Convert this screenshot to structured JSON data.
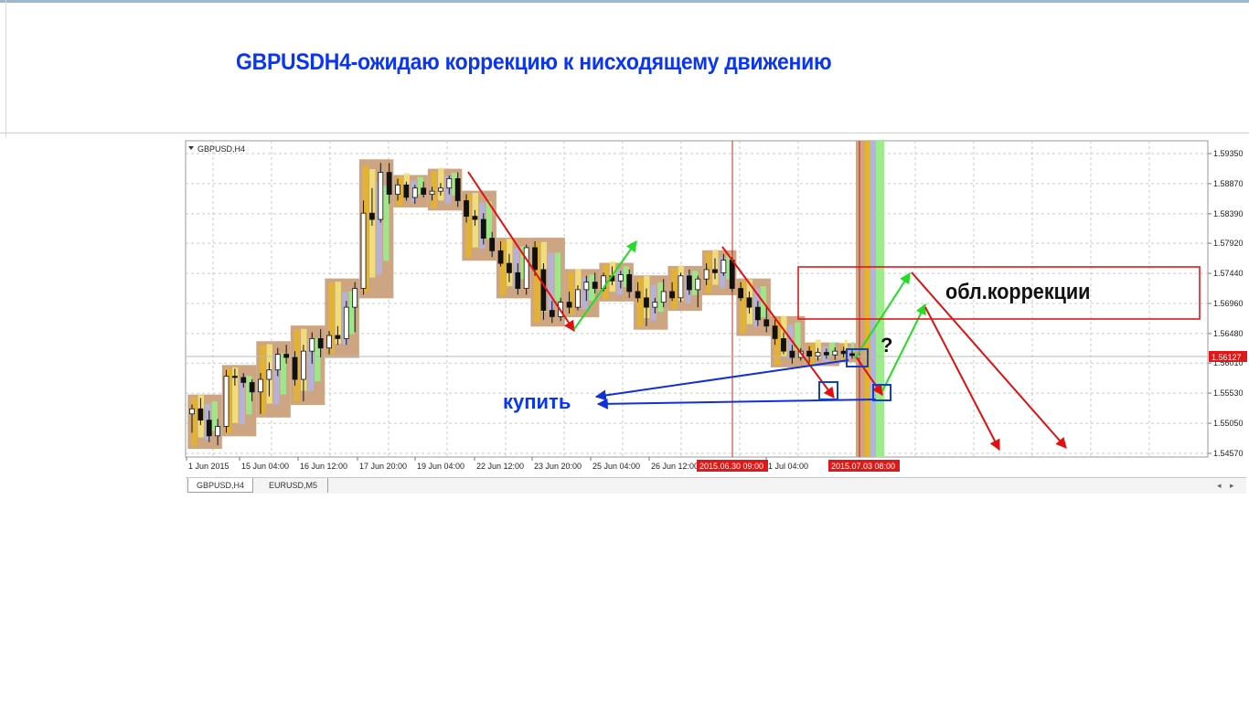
{
  "page": {
    "title": "GBPUSDH4-ожидаю коррекцию к нисходящему движению"
  },
  "tabs": {
    "active": "GBPUSD,H4",
    "other": "EURUSD,M5",
    "scroll_left": "◂",
    "scroll_right": "▸"
  },
  "chart_data": {
    "type": "candlestick",
    "symbol_label": "GBPUSD,H4",
    "ylim": [
      1.5442,
      1.5955
    ],
    "y_ticks": [
      "1.59350",
      "1.58870",
      "1.58390",
      "1.57920",
      "1.57440",
      "1.56960",
      "1.56480",
      "1.56010",
      "1.55530",
      "1.55050",
      "1.54570"
    ],
    "x_tick_labels": [
      "1 Jun 2015",
      "15 Jun 04:00",
      "16 Jun 12:00",
      "17 Jun 20:00",
      "19 Jun 04:00",
      "22 Jun 12:00",
      "23 Jun 20:00",
      "25 Jun 04:00",
      "26 Jun 12:00",
      "1 Jul 04:00"
    ],
    "x_highlight_labels": [
      "2015.06.30 09:00",
      "2015.07.03 08:00"
    ],
    "current_price": "1.56127",
    "grid": true,
    "annotations": {
      "buy_label": "купить",
      "zone_label": "обл.коррекции",
      "question_mark": "?"
    },
    "colors": {
      "title": "#0a35f2",
      "buy_label": "#0a35f2",
      "arrow_down": "#e01010",
      "arrow_up": "#22dd22",
      "arrow_buy": "#1030d8",
      "zone_box": "#e01818",
      "marker_box": "#1040d0",
      "price_badge_bg": "#e01818",
      "band_tan": "#cda583",
      "band_gold": "#e4b42a",
      "band_yellow": "#f3e27a",
      "band_lavender": "#b3b3e0",
      "band_green": "#9cec8c",
      "vline": "#d02020"
    },
    "candles": [
      {
        "o": 1.552,
        "h": 1.5535,
        "l": 1.549,
        "c": 1.5528
      },
      {
        "o": 1.5528,
        "h": 1.5545,
        "l": 1.5502,
        "c": 1.551
      },
      {
        "o": 1.551,
        "h": 1.5525,
        "l": 1.5475,
        "c": 1.5485
      },
      {
        "o": 1.5485,
        "h": 1.5512,
        "l": 1.547,
        "c": 1.55
      },
      {
        "o": 1.55,
        "h": 1.559,
        "l": 1.549,
        "c": 1.558
      },
      {
        "o": 1.558,
        "h": 1.5592,
        "l": 1.5565,
        "c": 1.5578
      },
      {
        "o": 1.5578,
        "h": 1.5585,
        "l": 1.5562,
        "c": 1.557
      },
      {
        "o": 1.557,
        "h": 1.5575,
        "l": 1.554,
        "c": 1.5555
      },
      {
        "o": 1.5555,
        "h": 1.5585,
        "l": 1.552,
        "c": 1.5575
      },
      {
        "o": 1.5575,
        "h": 1.5602,
        "l": 1.5548,
        "c": 1.559
      },
      {
        "o": 1.559,
        "h": 1.5625,
        "l": 1.558,
        "c": 1.5615
      },
      {
        "o": 1.5615,
        "h": 1.563,
        "l": 1.56,
        "c": 1.561
      },
      {
        "o": 1.561,
        "h": 1.562,
        "l": 1.5565,
        "c": 1.5575
      },
      {
        "o": 1.5575,
        "h": 1.563,
        "l": 1.554,
        "c": 1.562
      },
      {
        "o": 1.562,
        "h": 1.565,
        "l": 1.56,
        "c": 1.564
      },
      {
        "o": 1.564,
        "h": 1.5655,
        "l": 1.561,
        "c": 1.5625
      },
      {
        "o": 1.5625,
        "h": 1.5652,
        "l": 1.5615,
        "c": 1.5645
      },
      {
        "o": 1.5645,
        "h": 1.566,
        "l": 1.563,
        "c": 1.564
      },
      {
        "o": 1.564,
        "h": 1.57,
        "l": 1.563,
        "c": 1.569
      },
      {
        "o": 1.569,
        "h": 1.573,
        "l": 1.565,
        "c": 1.572
      },
      {
        "o": 1.572,
        "h": 1.586,
        "l": 1.571,
        "c": 1.584
      },
      {
        "o": 1.584,
        "h": 1.588,
        "l": 1.582,
        "c": 1.583
      },
      {
        "o": 1.583,
        "h": 1.592,
        "l": 1.5825,
        "c": 1.5905
      },
      {
        "o": 1.5905,
        "h": 1.592,
        "l": 1.5855,
        "c": 1.587
      },
      {
        "o": 1.587,
        "h": 1.5895,
        "l": 1.586,
        "c": 1.5885
      },
      {
        "o": 1.5885,
        "h": 1.589,
        "l": 1.586,
        "c": 1.5865
      },
      {
        "o": 1.5865,
        "h": 1.5885,
        "l": 1.5855,
        "c": 1.588
      },
      {
        "o": 1.588,
        "h": 1.589,
        "l": 1.5865,
        "c": 1.587
      },
      {
        "o": 1.587,
        "h": 1.5882,
        "l": 1.586,
        "c": 1.5875
      },
      {
        "o": 1.5875,
        "h": 1.5888,
        "l": 1.5868,
        "c": 1.588
      },
      {
        "o": 1.588,
        "h": 1.59,
        "l": 1.587,
        "c": 1.5895
      },
      {
        "o": 1.5895,
        "h": 1.5905,
        "l": 1.585,
        "c": 1.586
      },
      {
        "o": 1.586,
        "h": 1.587,
        "l": 1.5825,
        "c": 1.5835
      },
      {
        "o": 1.5835,
        "h": 1.5845,
        "l": 1.582,
        "c": 1.583
      },
      {
        "o": 1.583,
        "h": 1.584,
        "l": 1.579,
        "c": 1.58
      },
      {
        "o": 1.58,
        "h": 1.581,
        "l": 1.577,
        "c": 1.578
      },
      {
        "o": 1.578,
        "h": 1.5795,
        "l": 1.5755,
        "c": 1.576
      },
      {
        "o": 1.576,
        "h": 1.5775,
        "l": 1.573,
        "c": 1.5745
      },
      {
        "o": 1.5745,
        "h": 1.576,
        "l": 1.571,
        "c": 1.572
      },
      {
        "o": 1.572,
        "h": 1.579,
        "l": 1.571,
        "c": 1.5785
      },
      {
        "o": 1.5785,
        "h": 1.5795,
        "l": 1.574,
        "c": 1.575
      },
      {
        "o": 1.575,
        "h": 1.576,
        "l": 1.567,
        "c": 1.5685
      },
      {
        "o": 1.5685,
        "h": 1.57,
        "l": 1.5665,
        "c": 1.5675
      },
      {
        "o": 1.5675,
        "h": 1.5705,
        "l": 1.5668,
        "c": 1.5698
      },
      {
        "o": 1.5698,
        "h": 1.5715,
        "l": 1.568,
        "c": 1.569
      },
      {
        "o": 1.569,
        "h": 1.5725,
        "l": 1.5685,
        "c": 1.5718
      },
      {
        "o": 1.5718,
        "h": 1.574,
        "l": 1.57,
        "c": 1.573
      },
      {
        "o": 1.573,
        "h": 1.5745,
        "l": 1.5712,
        "c": 1.572
      },
      {
        "o": 1.572,
        "h": 1.5745,
        "l": 1.5715,
        "c": 1.574
      },
      {
        "o": 1.574,
        "h": 1.5755,
        "l": 1.5725,
        "c": 1.5732
      },
      {
        "o": 1.5732,
        "h": 1.5748,
        "l": 1.572,
        "c": 1.5742
      },
      {
        "o": 1.5742,
        "h": 1.575,
        "l": 1.5705,
        "c": 1.5715
      },
      {
        "o": 1.5715,
        "h": 1.573,
        "l": 1.5698,
        "c": 1.5705
      },
      {
        "o": 1.5705,
        "h": 1.572,
        "l": 1.566,
        "c": 1.569
      },
      {
        "o": 1.569,
        "h": 1.5705,
        "l": 1.568,
        "c": 1.5698
      },
      {
        "o": 1.5698,
        "h": 1.5735,
        "l": 1.569,
        "c": 1.5715
      },
      {
        "o": 1.5715,
        "h": 1.573,
        "l": 1.57,
        "c": 1.5705
      },
      {
        "o": 1.5705,
        "h": 1.5745,
        "l": 1.5698,
        "c": 1.574
      },
      {
        "o": 1.574,
        "h": 1.575,
        "l": 1.571,
        "c": 1.5718
      },
      {
        "o": 1.5718,
        "h": 1.574,
        "l": 1.569,
        "c": 1.5735
      },
      {
        "o": 1.5735,
        "h": 1.576,
        "l": 1.5725,
        "c": 1.575
      },
      {
        "o": 1.575,
        "h": 1.5768,
        "l": 1.5735,
        "c": 1.5745
      },
      {
        "o": 1.5745,
        "h": 1.5775,
        "l": 1.574,
        "c": 1.5765
      },
      {
        "o": 1.5765,
        "h": 1.577,
        "l": 1.5715,
        "c": 1.572
      },
      {
        "o": 1.572,
        "h": 1.573,
        "l": 1.57,
        "c": 1.5705
      },
      {
        "o": 1.5705,
        "h": 1.5715,
        "l": 1.568,
        "c": 1.569
      },
      {
        "o": 1.569,
        "h": 1.57,
        "l": 1.566,
        "c": 1.567
      },
      {
        "o": 1.567,
        "h": 1.569,
        "l": 1.565,
        "c": 1.566
      },
      {
        "o": 1.566,
        "h": 1.567,
        "l": 1.563,
        "c": 1.564
      },
      {
        "o": 1.564,
        "h": 1.565,
        "l": 1.5615,
        "c": 1.562
      },
      {
        "o": 1.562,
        "h": 1.563,
        "l": 1.56,
        "c": 1.561
      },
      {
        "o": 1.561,
        "h": 1.5625,
        "l": 1.5605,
        "c": 1.562
      },
      {
        "o": 1.562,
        "h": 1.5628,
        "l": 1.5602,
        "c": 1.5612
      },
      {
        "o": 1.5612,
        "h": 1.5625,
        "l": 1.5605,
        "c": 1.5618
      },
      {
        "o": 1.5618,
        "h": 1.5624,
        "l": 1.5608,
        "c": 1.5614
      },
      {
        "o": 1.5614,
        "h": 1.5626,
        "l": 1.5606,
        "c": 1.562
      },
      {
        "o": 1.562,
        "h": 1.5627,
        "l": 1.561,
        "c": 1.5616
      },
      {
        "o": 1.5616,
        "h": 1.5622,
        "l": 1.5608,
        "c": 1.5613
      }
    ]
  }
}
